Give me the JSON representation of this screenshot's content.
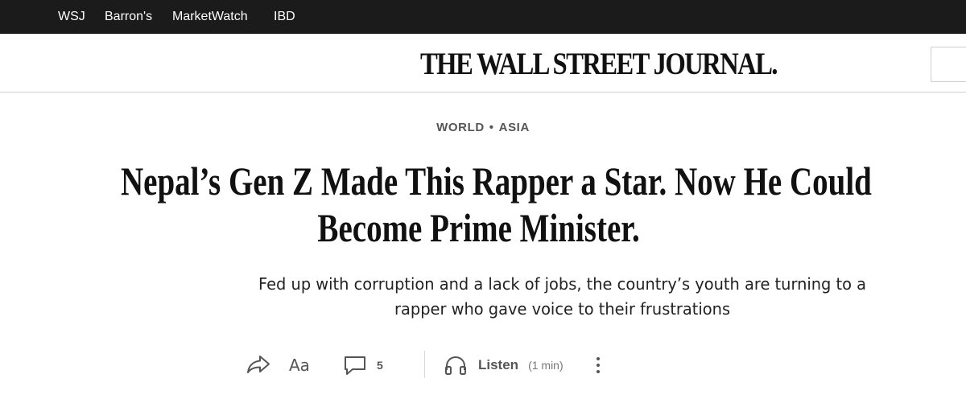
{
  "topbar": {
    "links": [
      "WSJ",
      "Barron's",
      "MarketWatch",
      "IBD"
    ]
  },
  "masthead": {
    "logo": "THE WALL STREET JOURNAL."
  },
  "article": {
    "section": "WORLD",
    "subsection": "ASIA",
    "separator": "•",
    "headline_lines": [
      "Nepal’s Gen Z Made This Rapper a Star. Now He Could",
      "Become Prime Minister."
    ],
    "dek_lines": [
      "Fed up with corruption and a lack of jobs, the country’s youth are turning to a",
      "rapper who gave voice to their frustrations"
    ]
  },
  "tools": {
    "font_label": "Aa",
    "comment_count": "5",
    "listen_label": "Listen",
    "listen_duration": "(1 min)",
    "icons": [
      "share-icon",
      "text-size-icon",
      "comment-icon",
      "headphones-icon",
      "more-vertical-icon"
    ],
    "icon_color": "#555555"
  },
  "colors": {
    "topbar_bg": "#1b1b1b",
    "text": "#111111",
    "muted": "#555555"
  }
}
